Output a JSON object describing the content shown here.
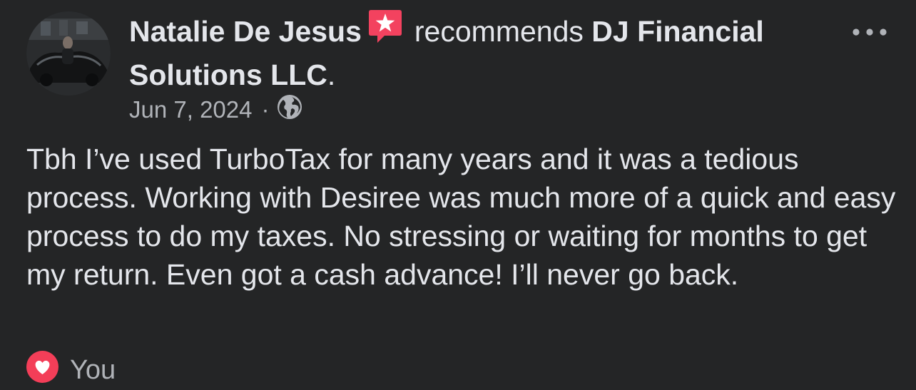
{
  "post": {
    "author": "Natalie De Jesus",
    "recommends_text": "recommends",
    "page_name": "DJ Financial Solutions LLC",
    "period": ".",
    "date": "Jun 7, 2024",
    "separator": "·",
    "audience_icon": "globe-icon",
    "badge_icon": "recommendation-star-icon",
    "more_icon": "more-horizontal-icon",
    "body": "Tbh I’ve used TurboTax for many years and it was a tedious process. Working with Desiree was much more of a quick and easy process to do my taxes. No stressing or waiting for months to get my return. Even got a cash advance! I’ll never go back."
  },
  "reactions": {
    "icon": "love-reaction-icon",
    "label": "You"
  },
  "colors": {
    "background": "#242526",
    "primary_text": "#e4e6eb",
    "secondary_text": "#b0b3b8",
    "recommend_badge": "#f3425f",
    "love_reaction": "#f33e58"
  }
}
